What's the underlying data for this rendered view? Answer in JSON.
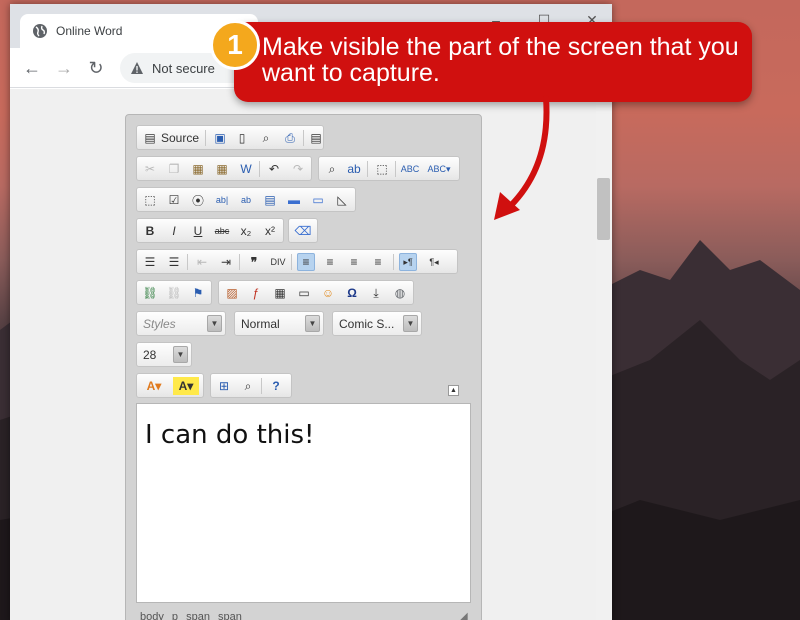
{
  "browser": {
    "tab_title": "Online Word",
    "security_label": "Not secure",
    "window_controls": [
      "minimize",
      "maximize",
      "close"
    ]
  },
  "editor": {
    "source_label": "Source",
    "styles_placeholder": "Styles",
    "format_value": "Normal",
    "font_value": "Comic S...",
    "size_value": "28",
    "content_text": "I can do this!",
    "elements_path": [
      "body",
      "p",
      "span",
      "span"
    ]
  },
  "callout": {
    "step_number": "1",
    "text": "Make visible the part of the screen that you want to capture.",
    "color": "#d0100f",
    "badge_color": "#f4a81d"
  },
  "icons": [
    "source-icon",
    "save-icon",
    "new-page-icon",
    "preview-icon",
    "print-icon",
    "templates-icon",
    "cut-icon",
    "copy-icon",
    "paste-icon",
    "paste-text-icon",
    "paste-word-icon",
    "undo-icon",
    "redo-icon",
    "find-icon",
    "replace-icon",
    "select-all-icon",
    "spellcheck-icon",
    "scayt-icon",
    "form-icon",
    "checkbox-icon",
    "radio-icon",
    "textfield-icon",
    "textarea-icon",
    "select-icon",
    "button-icon",
    "imagebutton-icon",
    "hiddenfield-icon",
    "bold-icon",
    "italic-icon",
    "underline-icon",
    "strike-icon",
    "subscript-icon",
    "superscript-icon",
    "remove-format-icon",
    "numbered-list-icon",
    "bulleted-list-icon",
    "outdent-icon",
    "indent-icon",
    "blockquote-icon",
    "div-icon",
    "align-left-icon",
    "align-center-icon",
    "align-right-icon",
    "justify-icon",
    "ltr-icon",
    "rtl-icon",
    "link-icon",
    "unlink-icon",
    "anchor-icon",
    "image-icon",
    "flash-icon",
    "table-icon",
    "horizontal-rule-icon",
    "smiley-icon",
    "special-char-icon",
    "page-break-icon",
    "iframe-icon",
    "text-color-icon",
    "bg-color-icon",
    "maximize-icon",
    "show-blocks-icon",
    "about-icon"
  ]
}
